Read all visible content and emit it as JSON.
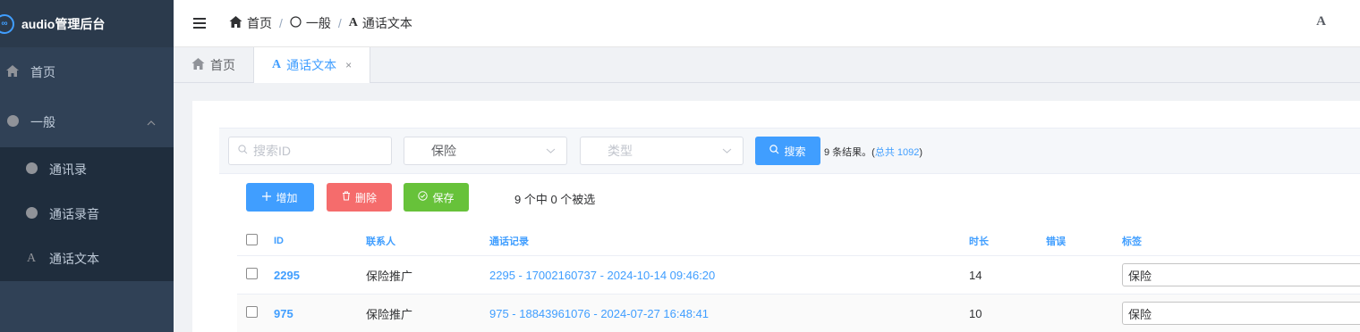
{
  "app": {
    "title": "audio管理后台",
    "logo_text": "∞"
  },
  "sidebar": {
    "items": [
      {
        "label": "首页",
        "icon": "home-icon"
      },
      {
        "label": "一般",
        "icon": "circle-icon",
        "expanded": true
      }
    ],
    "subitems": [
      {
        "label": "通讯录",
        "icon": "circle-icon"
      },
      {
        "label": "通话录音",
        "icon": "circle-icon"
      },
      {
        "label": "通话文本",
        "icon": "text-a-icon",
        "glyph": "A"
      }
    ]
  },
  "header": {
    "breadcrumb": [
      {
        "label": "首页",
        "icon": "home-icon"
      },
      {
        "label": "一般",
        "icon": "circle-outline-icon"
      },
      {
        "label": "通话文本",
        "icon": "text-a-icon",
        "glyph": "A"
      }
    ],
    "right_glyph": "A"
  },
  "tabs": [
    {
      "label": "首页",
      "active": false
    },
    {
      "label": "通话文本",
      "active": true,
      "glyph": "A",
      "close": "×"
    }
  ],
  "filters": {
    "search_placeholder": "搜索ID",
    "category_value": "保险",
    "type_placeholder": "类型",
    "search_button": "搜索",
    "result_text": "9 条结果。(",
    "result_total": "总共 1092",
    "result_close": ")"
  },
  "actions": {
    "add_label": "增加",
    "delete_label": "删除",
    "save_label": "保存",
    "selected_text": "9 个中 0 个被选"
  },
  "table": {
    "headers": {
      "id": "ID",
      "contact": "联系人",
      "record": "通话记录",
      "duration": "时长",
      "error": "错误",
      "tag": "标签"
    },
    "rows": [
      {
        "id": "2295",
        "contact": "保险推广",
        "record": "2295 - 17002160737 - 2024-10-14 09:46:20",
        "duration": "14",
        "error": "",
        "tag": "保险"
      },
      {
        "id": "975",
        "contact": "保险推广",
        "record": "975 - 18843961076 - 2024-07-27 16:48:41",
        "duration": "10",
        "error": "",
        "tag": "保险"
      }
    ]
  },
  "colors": {
    "sidebar_bg": "#304156",
    "submenu_bg": "#1f2d3d",
    "primary": "#409eff",
    "danger": "#f56c6c",
    "success": "#67c23a"
  }
}
